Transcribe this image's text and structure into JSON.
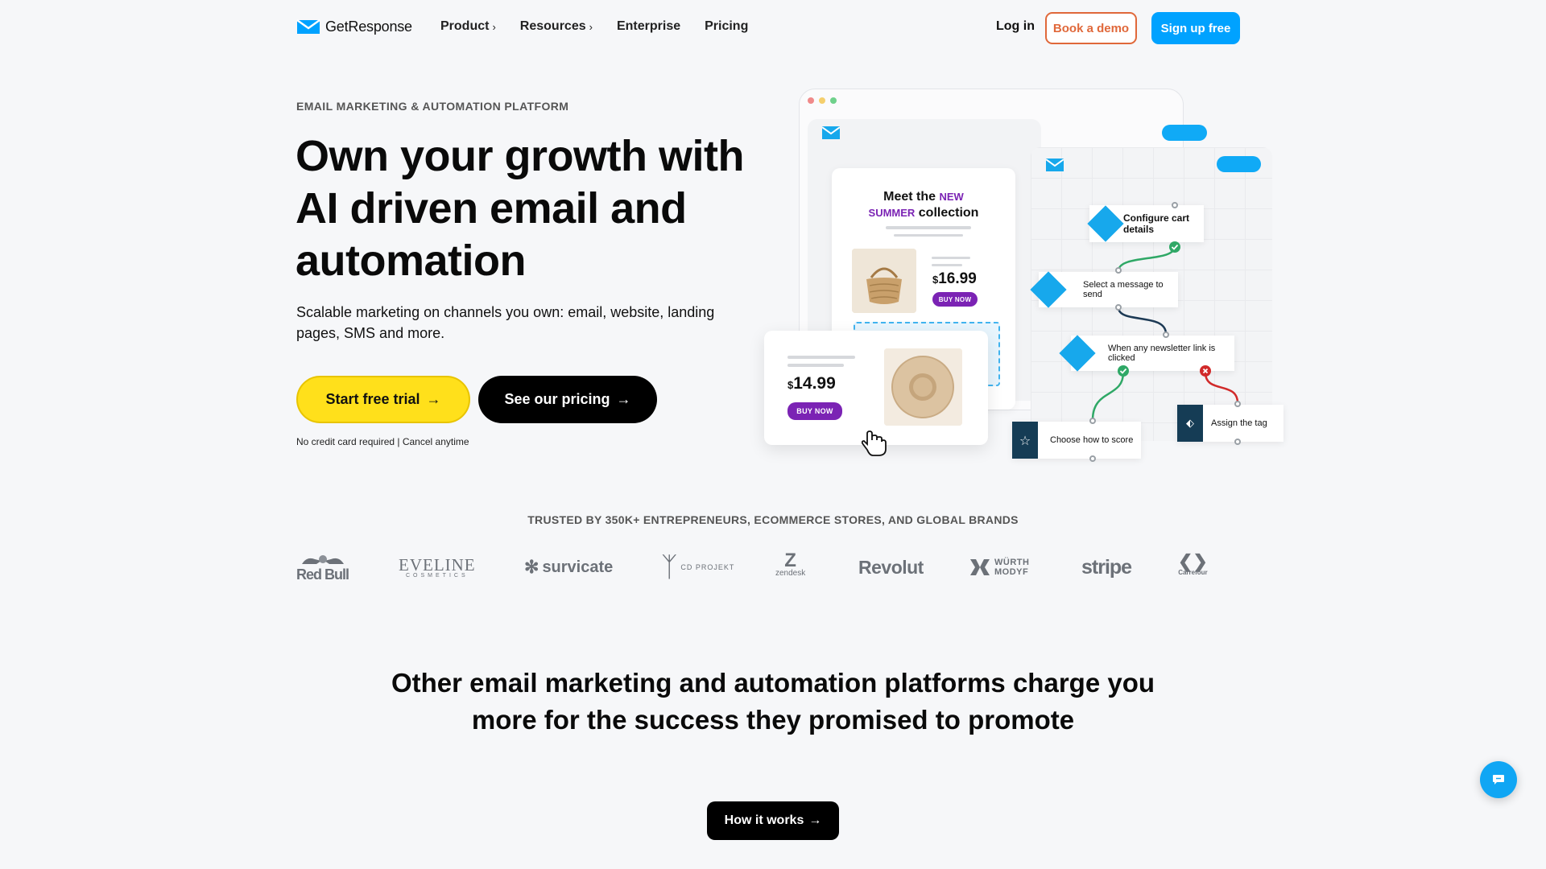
{
  "header": {
    "brand": "GetResponse",
    "nav": [
      {
        "label": "Product",
        "chevron": "›"
      },
      {
        "label": "Resources",
        "chevron": "›"
      },
      {
        "label": "Enterprise",
        "chevron": ""
      },
      {
        "label": "Pricing",
        "chevron": ""
      }
    ],
    "login": "Log in",
    "book_demo": "Book a demo",
    "signup": "Sign up free"
  },
  "hero": {
    "eyebrow": "EMAIL MARKETING & AUTOMATION PLATFORM",
    "title": "Own your growth with AI driven email and automation",
    "subtitle": "Scalable marketing on channels you own: email, website, landing pages, SMS and more.",
    "cta_trial": "Start free trial",
    "cta_pricing": "See our pricing",
    "arrow": "→",
    "note": "No credit card required | Cancel anytime"
  },
  "illustration": {
    "mail_title_1": "Meet the",
    "mail_title_new": "NEW",
    "mail_title_summer": "SUMMER",
    "mail_title_2": "collection",
    "product1_price": "16.99",
    "product2_price": "14.99",
    "currency": "$",
    "buy_now": "BUY NOW",
    "flow": {
      "n1": "Configure cart details",
      "n2": "Select a message to send",
      "n3": "When any newsletter link is clicked",
      "n4": "Choose how to score",
      "n5": "Assign the tag"
    },
    "colors": {
      "accent": "#17a8ec",
      "purple": "#7b23b4",
      "dark": "#153c55"
    }
  },
  "trusted": {
    "title": "TRUSTED BY 350K+ ENTREPRENEURS, ECOMMERCE STORES, AND GLOBAL BRANDS",
    "brands": {
      "redbull": "Red Bull",
      "eveline": "EVELINE",
      "eveline_sub": "COSMETICS",
      "survicate": "survicate",
      "cdprojekt": "CD PROJEKT",
      "zendesk": "zendesk",
      "revolut": "Revolut",
      "wurth_1": "WÜRTH",
      "wurth_2": "MODYF",
      "stripe": "stripe",
      "carrefour": "Carrefour"
    }
  },
  "section2": {
    "title": "Other email marketing and automation platforms charge you more for the success they promised to promote",
    "cta": "How it works",
    "arrow": "→"
  },
  "colors": {
    "brand_blue": "#00a2ff",
    "yellow": "#ffe01b",
    "orange": "#e0683a"
  }
}
